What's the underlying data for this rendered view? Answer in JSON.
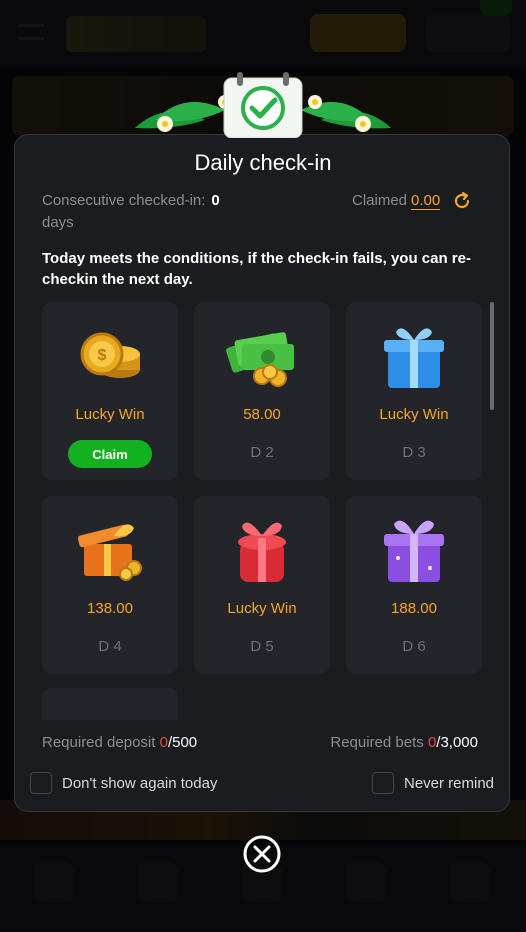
{
  "modal": {
    "title": "Daily check-in",
    "consecutive_label": "Consecutive checked-in:",
    "consecutive_value": "0",
    "consecutive_unit": "days",
    "claimed_label": "Claimed",
    "claimed_value": "0.00",
    "note": "Today meets the conditions, if the check-in fails, you can re-checkin the next day.",
    "days": [
      {
        "amount": "Lucky Win",
        "day": "",
        "icon": "coin-stack-icon",
        "claim_label": "Claim"
      },
      {
        "amount": "58.00",
        "day": "D 2",
        "icon": "cash-coins-icon"
      },
      {
        "amount": "Lucky Win",
        "day": "D 3",
        "icon": "blue-gift-icon"
      },
      {
        "amount": "138.00",
        "day": "D 4",
        "icon": "orange-gift-icon"
      },
      {
        "amount": "Lucky Win",
        "day": "D 5",
        "icon": "red-gift-icon"
      },
      {
        "amount": "188.00",
        "day": "D 6",
        "icon": "purple-gift-icon"
      }
    ],
    "required_deposit_label": "Required deposit",
    "required_deposit_current": "0",
    "required_deposit_total": "/500",
    "required_bets_label": "Required bets",
    "required_bets_current": "0",
    "required_bets_total": "/3,000",
    "dont_show_label": "Don't show again today",
    "never_remind_label": "Never remind"
  },
  "colors": {
    "accent": "#f5a623",
    "claim_green": "#13b11f",
    "alert_red": "#e8453c"
  }
}
